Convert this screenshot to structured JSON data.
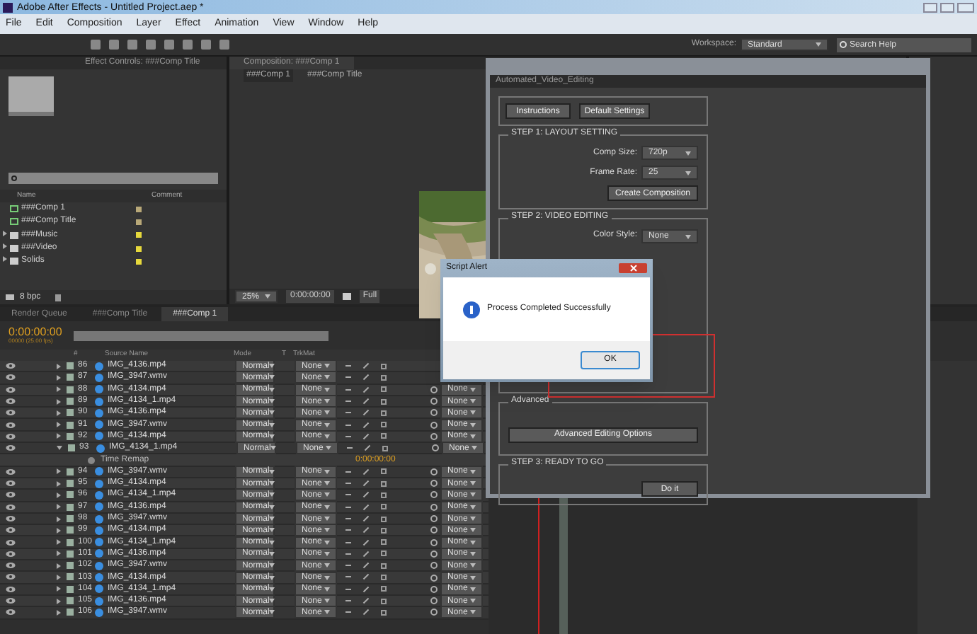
{
  "window": {
    "title": "Adobe After Effects - Untitled Project.aep *"
  },
  "menu": [
    "File",
    "Edit",
    "Composition",
    "Layer",
    "Effect",
    "Animation",
    "View",
    "Window",
    "Help"
  ],
  "toolbar": {
    "workspace_label": "Workspace:",
    "workspace": "Standard",
    "search": {
      "placeholder": "Search Help"
    }
  },
  "project_panel": {
    "tab": "Effect Controls: ###Comp Title",
    "columns": [
      "Name",
      "Comment"
    ],
    "items": [
      {
        "name": "###Comp 1",
        "kind": "comp",
        "color": "#b8a878"
      },
      {
        "name": "###Comp Title",
        "kind": "comp",
        "color": "#b8a878"
      },
      {
        "name": "###Music",
        "kind": "folder",
        "color": "#e6d83c"
      },
      {
        "name": "###Video",
        "kind": "folder",
        "color": "#e6d83c"
      },
      {
        "name": "Solids",
        "kind": "folder",
        "color": "#e6d83c"
      }
    ],
    "bit_depth": "8 bpc"
  },
  "composition_panel": {
    "tab": "Composition: ###Comp 1",
    "breadcrumbs": [
      "###Comp 1",
      "###Comp Title"
    ],
    "zoom": "25%",
    "timecode": "0:00:00:00",
    "resolution": "Full"
  },
  "timeline": {
    "tabs": [
      {
        "label": "Render Queue",
        "selected": false
      },
      {
        "label": "###Comp Title",
        "selected": false
      },
      {
        "label": "###Comp 1",
        "selected": true
      }
    ],
    "timecode": "0:00:00:00",
    "frame": "00000 (25.00 fps)",
    "columns": [
      "#",
      "Source Name",
      "Mode",
      "T",
      "TrkMat"
    ],
    "layers": [
      {
        "kind": "layer",
        "number": "86",
        "name": "IMG_4136.mp4",
        "mode": "Normal",
        "trkmat": "None",
        "expanded": false
      },
      {
        "kind": "layer",
        "number": "87",
        "name": "IMG_3947.wmv",
        "mode": "Normal",
        "trkmat": "None",
        "expanded": false
      },
      {
        "kind": "layer",
        "number": "88",
        "name": "IMG_4134.mp4",
        "mode": "Normal",
        "trkmat": "None",
        "expanded": false,
        "parent": "None"
      },
      {
        "kind": "layer",
        "number": "89",
        "name": "IMG_4134_1.mp4",
        "mode": "Normal",
        "trkmat": "None",
        "expanded": false,
        "parent": "None"
      },
      {
        "kind": "layer",
        "number": "90",
        "name": "IMG_4136.mp4",
        "mode": "Normal",
        "trkmat": "None",
        "expanded": false,
        "parent": "None"
      },
      {
        "kind": "layer",
        "number": "91",
        "name": "IMG_3947.wmv",
        "mode": "Normal",
        "trkmat": "None",
        "expanded": false,
        "parent": "None"
      },
      {
        "kind": "layer",
        "number": "92",
        "name": "IMG_4134.mp4",
        "mode": "Normal",
        "trkmat": "None",
        "expanded": false,
        "parent": "None"
      },
      {
        "kind": "layer",
        "number": "93",
        "name": "IMG_4134_1.mp4",
        "mode": "Normal",
        "trkmat": "None",
        "expanded": true,
        "parent": "None"
      },
      {
        "kind": "property",
        "name": "Time Remap",
        "value": "0:00:00:00"
      },
      {
        "kind": "layer",
        "number": "94",
        "name": "IMG_3947.wmv",
        "mode": "Normal",
        "trkmat": "None",
        "expanded": false,
        "parent": "None"
      },
      {
        "kind": "layer",
        "number": "95",
        "name": "IMG_4134.mp4",
        "mode": "Normal",
        "trkmat": "None",
        "expanded": false,
        "parent": "None"
      },
      {
        "kind": "layer",
        "number": "96",
        "name": "IMG_4134_1.mp4",
        "mode": "Normal",
        "trkmat": "None",
        "expanded": false,
        "parent": "None"
      },
      {
        "kind": "layer",
        "number": "97",
        "name": "IMG_4136.mp4",
        "mode": "Normal",
        "trkmat": "None",
        "expanded": false,
        "parent": "None"
      },
      {
        "kind": "layer",
        "number": "98",
        "name": "IMG_3947.wmv",
        "mode": "Normal",
        "trkmat": "None",
        "expanded": false,
        "parent": "None"
      },
      {
        "kind": "layer",
        "number": "99",
        "name": "IMG_4134.mp4",
        "mode": "Normal",
        "trkmat": "None",
        "expanded": false,
        "parent": "None"
      },
      {
        "kind": "layer",
        "number": "100",
        "name": "IMG_4134_1.mp4",
        "mode": "Normal",
        "trkmat": "None",
        "expanded": false,
        "parent": "None"
      },
      {
        "kind": "layer",
        "number": "101",
        "name": "IMG_4136.mp4",
        "mode": "Normal",
        "trkmat": "None",
        "expanded": false,
        "parent": "None"
      },
      {
        "kind": "layer",
        "number": "102",
        "name": "IMG_3947.wmv",
        "mode": "Normal",
        "trkmat": "None",
        "expanded": false,
        "parent": "None"
      },
      {
        "kind": "layer",
        "number": "103",
        "name": "IMG_4134.mp4",
        "mode": "Normal",
        "trkmat": "None",
        "expanded": false,
        "parent": "None"
      },
      {
        "kind": "layer",
        "number": "104",
        "name": "IMG_4134_1.mp4",
        "mode": "Normal",
        "trkmat": "None",
        "expanded": false,
        "parent": "None"
      },
      {
        "kind": "layer",
        "number": "105",
        "name": "IMG_4136.mp4",
        "mode": "Normal",
        "trkmat": "None",
        "expanded": false,
        "parent": "None"
      },
      {
        "kind": "layer",
        "number": "106",
        "name": "IMG_3947.wmv",
        "mode": "Normal",
        "trkmat": "None",
        "expanded": false,
        "parent": "None"
      }
    ]
  },
  "script_panel": {
    "title": "Automated_Video_Editing",
    "buttons": [
      "Instructions",
      "Default Settings"
    ],
    "step1": {
      "title": "STEP 1: LAYOUT SETTING",
      "comp_size_label": "Comp Size:",
      "comp_size": "720p",
      "frame_rate_label": "Frame Rate:",
      "frame_rate": "25",
      "button": "Create Composition"
    },
    "step2": {
      "title": "STEP 2: VIDEO EDITING",
      "color_style_label": "Color Style:",
      "color_style": "None"
    },
    "advanced": {
      "title": "Advanced",
      "button": "Advanced Editing Options"
    },
    "step3": {
      "title": "STEP 3: READY TO GO",
      "button": "Do it"
    }
  },
  "alert": {
    "title": "Script Alert",
    "message": "Process Completed Successfully",
    "button": "OK"
  }
}
